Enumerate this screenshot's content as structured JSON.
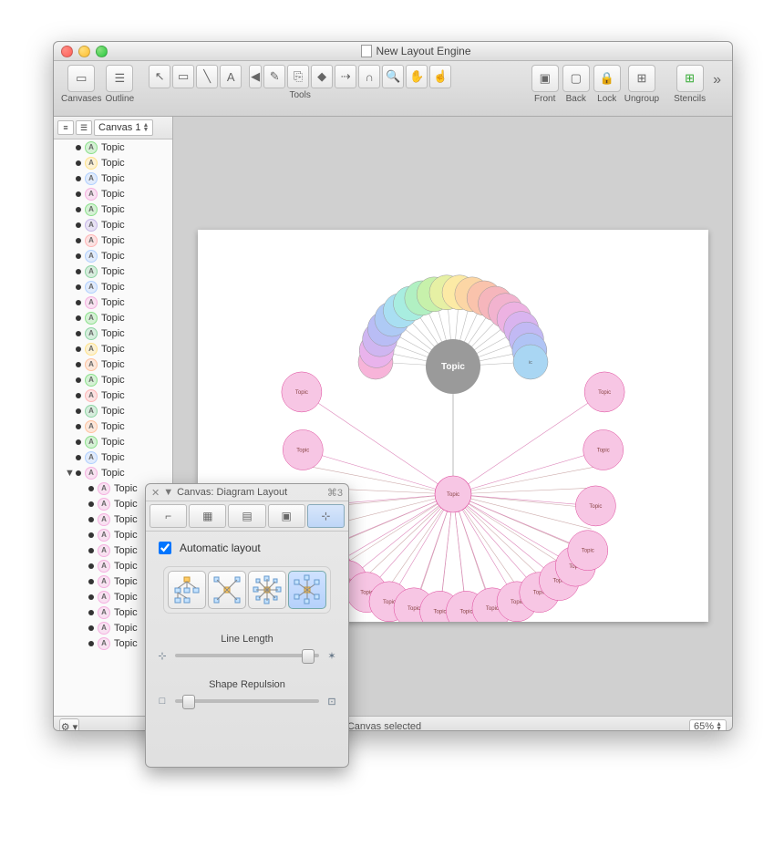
{
  "window": {
    "title": "New Layout Engine"
  },
  "toolbar": {
    "canvases": "Canvases",
    "outline": "Outline",
    "tools": "Tools",
    "front": "Front",
    "back": "Back",
    "lock": "Lock",
    "ungroup": "Ungroup",
    "stencils": "Stencils"
  },
  "sidebar": {
    "canvas_tab": "Canvas 1",
    "items": [
      {
        "label": "Topic",
        "c": "#8ce08c",
        "nested": false,
        "tri": ""
      },
      {
        "label": "Topic",
        "c": "#ffe28a",
        "nested": false,
        "tri": ""
      },
      {
        "label": "Topic",
        "c": "#b0d0ff",
        "nested": false,
        "tri": ""
      },
      {
        "label": "Topic",
        "c": "#f5b0e0",
        "nested": false,
        "tri": ""
      },
      {
        "label": "Topic",
        "c": "#8ce08c",
        "nested": false,
        "tri": ""
      },
      {
        "label": "Topic",
        "c": "#c5b5e8",
        "nested": false,
        "tri": ""
      },
      {
        "label": "Topic",
        "c": "#ffb5b5",
        "nested": false,
        "tri": ""
      },
      {
        "label": "Topic",
        "c": "#b0d0ff",
        "nested": false,
        "tri": ""
      },
      {
        "label": "Topic",
        "c": "#8fd5a5",
        "nested": false,
        "tri": ""
      },
      {
        "label": "Topic",
        "c": "#b0d0ff",
        "nested": false,
        "tri": ""
      },
      {
        "label": "Topic",
        "c": "#f5b0e0",
        "nested": false,
        "tri": ""
      },
      {
        "label": "Topic",
        "c": "#8ce08c",
        "nested": false,
        "tri": ""
      },
      {
        "label": "Topic",
        "c": "#8fd5a5",
        "nested": false,
        "tri": ""
      },
      {
        "label": "Topic",
        "c": "#ffe28a",
        "nested": false,
        "tri": ""
      },
      {
        "label": "Topic",
        "c": "#ffc29e",
        "nested": false,
        "tri": ""
      },
      {
        "label": "Topic",
        "c": "#8ce08c",
        "nested": false,
        "tri": ""
      },
      {
        "label": "Topic",
        "c": "#ffb5b5",
        "nested": false,
        "tri": ""
      },
      {
        "label": "Topic",
        "c": "#8fd5a5",
        "nested": false,
        "tri": ""
      },
      {
        "label": "Topic",
        "c": "#ffc29e",
        "nested": false,
        "tri": ""
      },
      {
        "label": "Topic",
        "c": "#8ce08c",
        "nested": false,
        "tri": ""
      },
      {
        "label": "Topic",
        "c": "#b0d0ff",
        "nested": false,
        "tri": ""
      },
      {
        "label": "Topic",
        "c": "#f5b0e0",
        "nested": false,
        "tri": "▼"
      },
      {
        "label": "Topic",
        "c": "#f5b0e0",
        "nested": true,
        "tri": ""
      },
      {
        "label": "Topic",
        "c": "#f5b0e0",
        "nested": true,
        "tri": ""
      },
      {
        "label": "Topic",
        "c": "#f5b0e0",
        "nested": true,
        "tri": ""
      },
      {
        "label": "Topic",
        "c": "#f5b0e0",
        "nested": true,
        "tri": ""
      },
      {
        "label": "Topic",
        "c": "#f5b0e0",
        "nested": true,
        "tri": ""
      },
      {
        "label": "Topic",
        "c": "#f5b0e0",
        "nested": true,
        "tri": ""
      },
      {
        "label": "Topic",
        "c": "#f5b0e0",
        "nested": true,
        "tri": ""
      },
      {
        "label": "Topic",
        "c": "#f5b0e0",
        "nested": true,
        "tri": ""
      },
      {
        "label": "Topic",
        "c": "#f5b0e0",
        "nested": true,
        "tri": ""
      },
      {
        "label": "Topic",
        "c": "#f5b0e0",
        "nested": true,
        "tri": ""
      },
      {
        "label": "Topic",
        "c": "#f5b0e0",
        "nested": true,
        "tri": ""
      }
    ]
  },
  "canvas": {
    "center_label": "Topic",
    "node_label": "Topic",
    "pink_hub_label": "Topic",
    "arc_colors": [
      "#f7b4d9",
      "#e9b3ec",
      "#cfb6f1",
      "#b9bdf5",
      "#aecaf5",
      "#a9dff2",
      "#a8ede0",
      "#b1f0c2",
      "#c7f1ab",
      "#e6f0a4",
      "#fceaa5",
      "#fcd6a5",
      "#fac3ac",
      "#f6b6bc",
      "#f2b3cf",
      "#edb2e2",
      "#d9b4ef",
      "#c2b9f4",
      "#b0c4f5",
      "#a9d6f3"
    ],
    "arc_count": 20,
    "pink_count": 20
  },
  "status": {
    "text": "Canvas selected",
    "zoom": "65%"
  },
  "palette": {
    "title": "Canvas: Diagram Layout",
    "shortcut": "⌘3",
    "auto_layout_label": "Automatic layout",
    "auto_layout_checked": true,
    "selected_type": 3,
    "line_length_label": "Line Length",
    "line_length_value": 0.88,
    "shape_repulsion_label": "Shape Repulsion",
    "shape_repulsion_value": 0.05
  }
}
